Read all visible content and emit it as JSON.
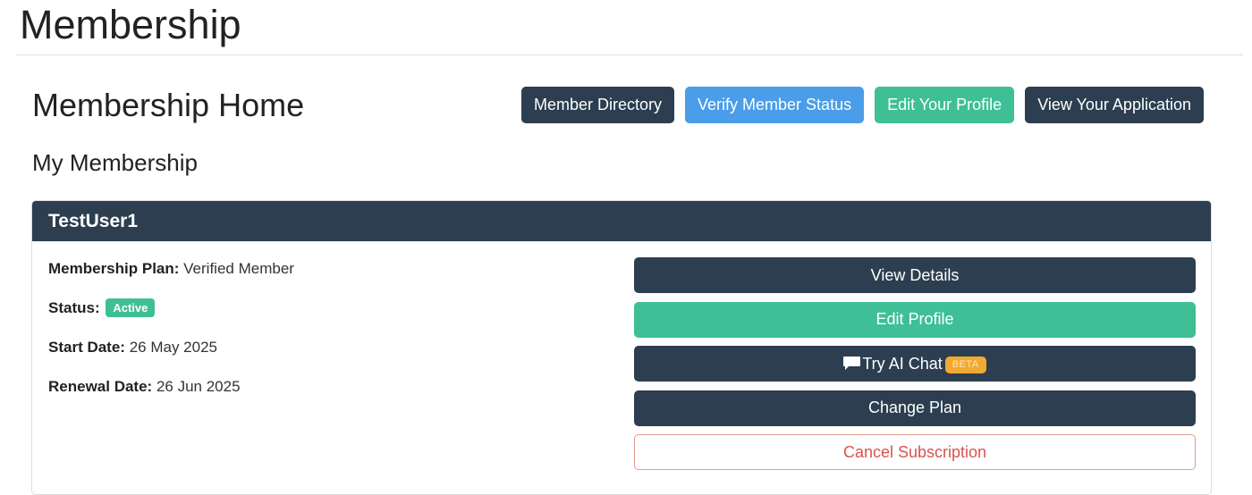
{
  "page": {
    "title": "Membership"
  },
  "header": {
    "heading": "Membership Home",
    "actions": {
      "member_directory": "Member Directory",
      "verify_member_status": "Verify Member Status",
      "edit_your_profile": "Edit Your Profile",
      "view_your_application": "View Your Application"
    }
  },
  "section": {
    "heading": "My Membership"
  },
  "card": {
    "username": "TestUser1",
    "fields": {
      "plan_label": "Membership Plan:",
      "plan_value": "Verified Member",
      "status_label": "Status:",
      "status_value": "Active",
      "start_label": "Start Date:",
      "start_value": "26 May 2025",
      "renewal_label": "Renewal Date:",
      "renewal_value": "26 Jun 2025"
    },
    "actions": {
      "view_details": "View Details",
      "edit_profile": "Edit Profile",
      "try_ai_chat": "Try AI Chat",
      "beta_badge": "BETA",
      "change_plan": "Change Plan",
      "cancel_subscription": "Cancel Subscription"
    }
  },
  "icons": {
    "chat": "chat-bubble-icon"
  },
  "colors": {
    "dark": "#2c3e50",
    "blue": "#4a9de8",
    "green": "#3fbf96",
    "danger": "#d9534f",
    "beta": "#f0a932"
  }
}
